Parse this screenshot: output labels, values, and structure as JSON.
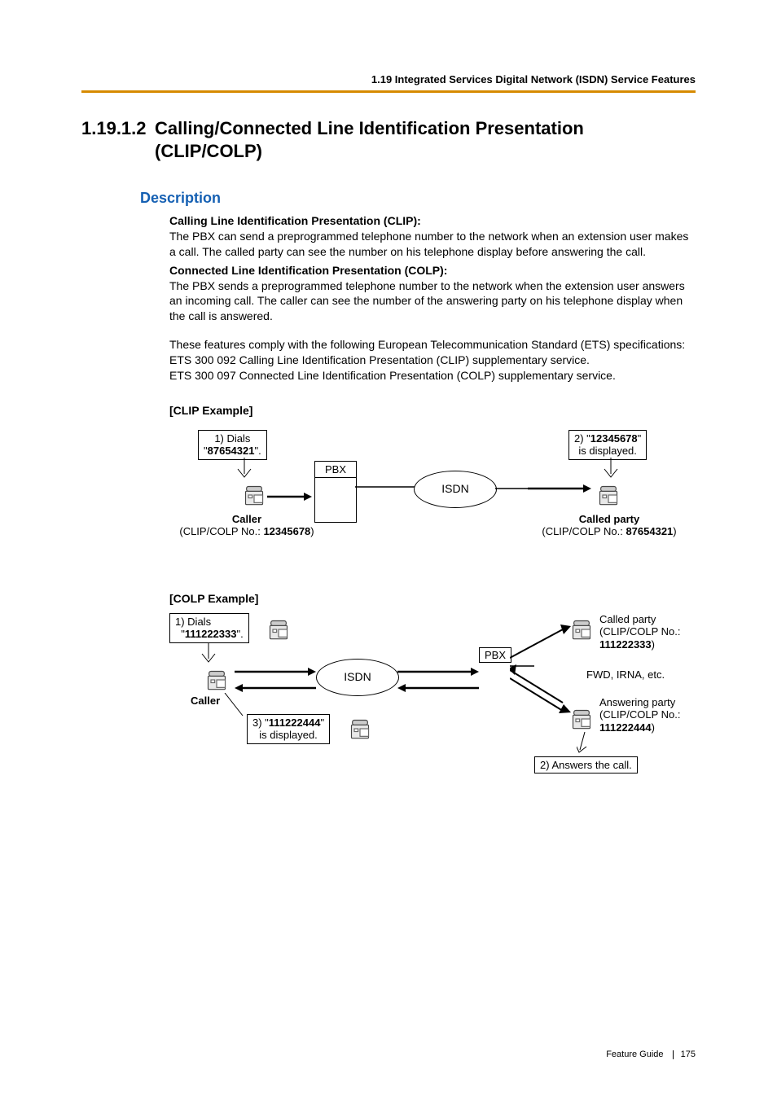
{
  "header": {
    "running_head": "1.19 Integrated Services Digital Network (ISDN) Service Features"
  },
  "section": {
    "number": "1.19.1.2",
    "title": "Calling/Connected Line Identification Presentation (CLIP/COLP)"
  },
  "description": {
    "heading": "Description",
    "clip_title": "Calling Line Identification Presentation (CLIP):",
    "clip_text": "The PBX can send a preprogrammed telephone number to the network when an extension user makes a call. The called party can see the number on his telephone display before answering the call.",
    "colp_title": "Connected Line Identification Presentation (COLP):",
    "colp_text": "The PBX sends a preprogrammed telephone number to the network when the extension user answers an incoming call. The caller can see the number of the answering party on his telephone display when the call is answered.",
    "ets_intro": "These features comply with the following European Telecommunication Standard (ETS) specifications:",
    "ets_line1": "ETS 300 092 Calling Line Identification Presentation (CLIP) supplementary service.",
    "ets_line2": "ETS 300 097 Connected Line Identification Presentation (COLP) supplementary service."
  },
  "clip_example": {
    "label": "[CLIP Example]",
    "step1_pre": "1) Dials",
    "step1_num": "87654321",
    "step1_post": "\".",
    "pbx": "PBX",
    "isdn": "ISDN",
    "step2_pre": "2) \"",
    "step2_num": "12345678",
    "step2_post": "\"",
    "step2_line2": "is displayed.",
    "caller_label": "Caller",
    "caller_sub_pre": "(CLIP/COLP No.: ",
    "caller_sub_num": "12345678",
    "caller_sub_post": ")",
    "called_label": "Called party",
    "called_sub_pre": "(CLIP/COLP No.: ",
    "called_sub_num": "87654321",
    "called_sub_post": ")"
  },
  "colp_example": {
    "label": "[COLP Example]",
    "step1_pre": "1) Dials",
    "step1_num": "111222333",
    "step1_post": "\".",
    "isdn": "ISDN",
    "pbx": "PBX",
    "caller_label": "Caller",
    "step3_pre": "3) \"",
    "step3_num": "111222444",
    "step3_post": "\"",
    "step3_line2": "is displayed.",
    "called_label": "Called party",
    "called_sub": "(CLIP/COLP No.:",
    "called_num": "111222333",
    "called_post": ")",
    "fwd": "FWD, IRNA, etc.",
    "answering_label": "Answering party",
    "answering_sub": "(CLIP/COLP No.:",
    "answering_num": "111222444",
    "answering_post": ")",
    "step2": "2) Answers the call."
  },
  "footer": {
    "guide": "Feature Guide",
    "page": "175"
  }
}
